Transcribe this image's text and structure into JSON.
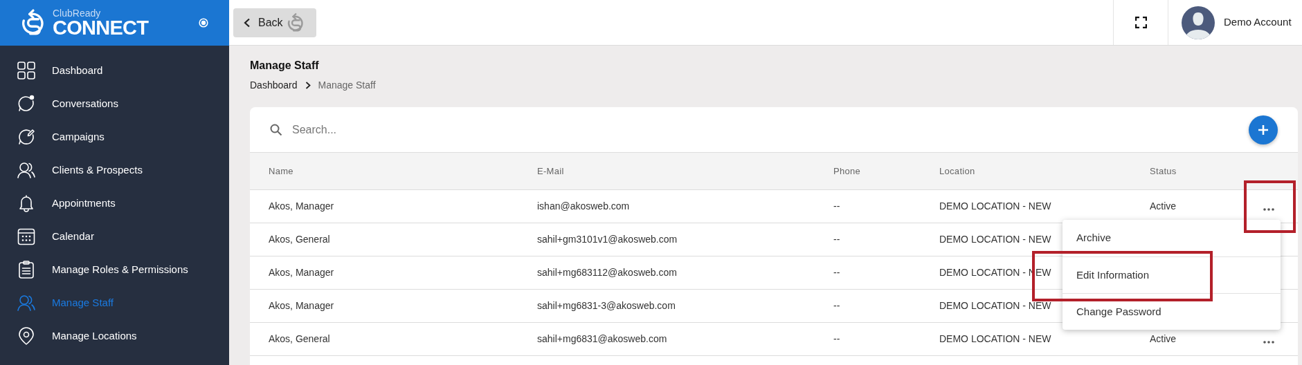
{
  "logo": {
    "brand": "ClubReady",
    "product": "CONNECT"
  },
  "sidebar": {
    "items": [
      {
        "label": "Dashboard",
        "selected": false
      },
      {
        "label": "Conversations",
        "selected": false
      },
      {
        "label": "Campaigns",
        "selected": false
      },
      {
        "label": "Clients & Prospects",
        "selected": false
      },
      {
        "label": "Appointments",
        "selected": false
      },
      {
        "label": "Calendar",
        "selected": false
      },
      {
        "label": "Manage Roles & Permissions",
        "selected": false
      },
      {
        "label": "Manage Staff",
        "selected": true
      },
      {
        "label": "Manage Locations",
        "selected": false
      }
    ]
  },
  "topbar": {
    "back_button": "Back",
    "account": "Demo Account"
  },
  "page": {
    "title": "Manage Staff",
    "breadcrumb": [
      "Dashboard",
      "Manage Staff"
    ]
  },
  "search": {
    "placeholder": "Search..."
  },
  "table": {
    "columns": [
      "Name",
      "E-Mail",
      "Phone",
      "Location",
      "Status"
    ],
    "rows": [
      {
        "name": "Akos, Manager",
        "email": "ishan@akosweb.com",
        "phone": "--",
        "location": "DEMO LOCATION - NEW",
        "status": "Active",
        "more_button": true
      },
      {
        "name": "Akos, General",
        "email": "sahil+gm3101v1@akosweb.com",
        "phone": "--",
        "location": "DEMO LOCATION - NEW",
        "more_button": false
      },
      {
        "name": "Akos, Manager",
        "email": "sahil+mg683112@akosweb.com",
        "phone": "--",
        "location": "DEMO LOCATION - NEW",
        "more_button": false
      },
      {
        "name": "Akos, Manager",
        "email": "sahil+mg6831-3@akosweb.com",
        "phone": "--",
        "location": "DEMO LOCATION - NEW",
        "more_button": false
      },
      {
        "name": "Akos, General",
        "email": "sahil+mg6831@akosweb.com",
        "phone": "--",
        "location": "DEMO LOCATION - NEW",
        "status": "Active",
        "more_button": true
      }
    ]
  },
  "row_menu": {
    "items": [
      "Archive",
      "Edit Information",
      "Change Password"
    ]
  }
}
